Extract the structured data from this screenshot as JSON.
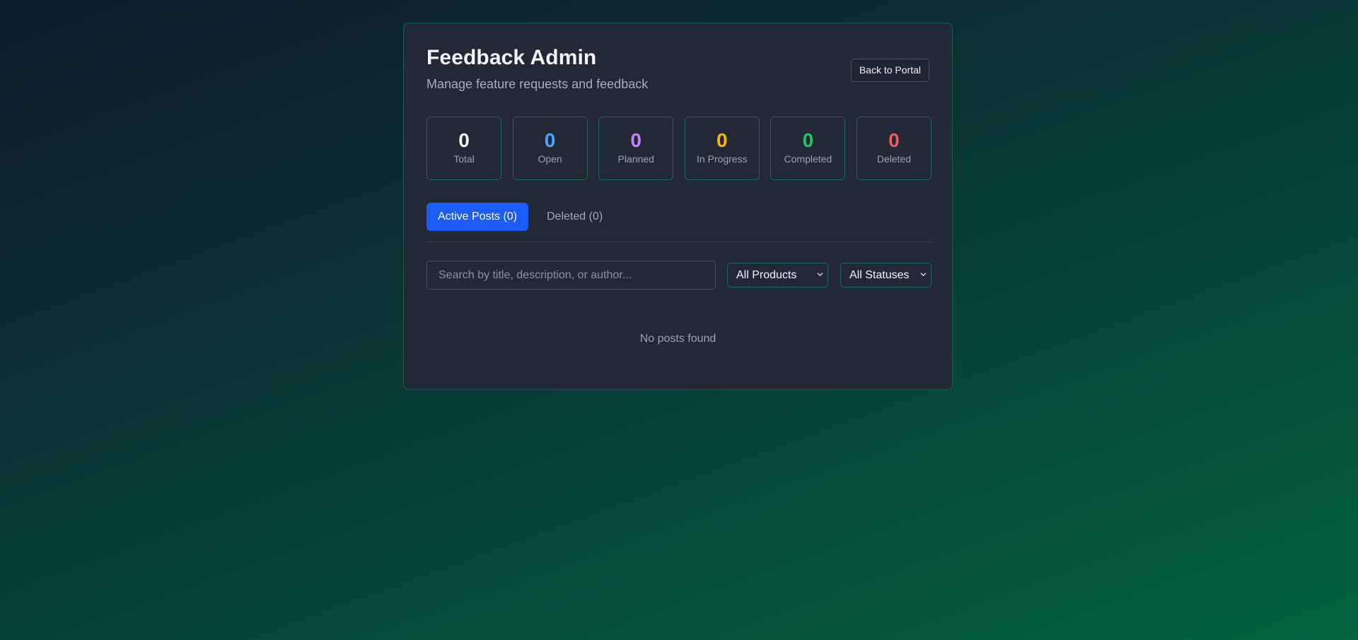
{
  "header": {
    "title": "Feedback Admin",
    "subtitle": "Manage feature requests and feedback",
    "back_label": "Back to Portal"
  },
  "stats": [
    {
      "value": "0",
      "label": "Total",
      "color": "#f2f4f7"
    },
    {
      "value": "0",
      "label": "Open",
      "color": "#4ea1ff"
    },
    {
      "value": "0",
      "label": "Planned",
      "color": "#c084fc"
    },
    {
      "value": "0",
      "label": "In Progress",
      "color": "#f5b50a"
    },
    {
      "value": "0",
      "label": "Completed",
      "color": "#22c55e"
    },
    {
      "value": "0",
      "label": "Deleted",
      "color": "#f25c5c"
    }
  ],
  "tabs": [
    {
      "label": "Active Posts (0)",
      "active": true
    },
    {
      "label": "Deleted (0)",
      "active": false
    }
  ],
  "filters": {
    "search_placeholder": "Search by title, description, or author...",
    "product_selected": "All Products",
    "status_selected": "All Statuses"
  },
  "empty_message": "No posts found",
  "colors": {
    "accent": "#1a5cf5",
    "card_border": "#1b6a50",
    "card_background": "#222836"
  },
  "icons": {
    "select_arrow": "chevron-down-icon"
  }
}
